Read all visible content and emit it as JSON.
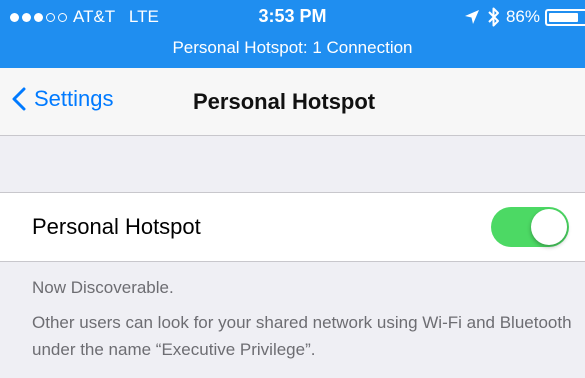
{
  "status_bar": {
    "carrier": "AT&T",
    "network": "LTE",
    "signal_dots_filled": 3,
    "signal_dots_total": 5,
    "time": "3:53 PM",
    "battery_percent": "86%",
    "battery_level": 0.86,
    "icons": [
      "location-arrow-icon",
      "bluetooth-icon",
      "battery-icon"
    ],
    "background_color": "#1f8ef0"
  },
  "hotspot_banner": "Personal Hotspot: 1 Connection",
  "nav": {
    "back_label": "Settings",
    "title": "Personal Hotspot"
  },
  "cell": {
    "label": "Personal Hotspot",
    "toggle_on": true,
    "toggle_color": "#4cd964"
  },
  "footer": {
    "discoverable": "Now Discoverable.",
    "description": "Other users can look for your shared network using Wi-Fi and Bluetooth under the name “Executive Privilege”."
  },
  "colors": {
    "accent": "#007aff",
    "background": "#efeff4"
  }
}
